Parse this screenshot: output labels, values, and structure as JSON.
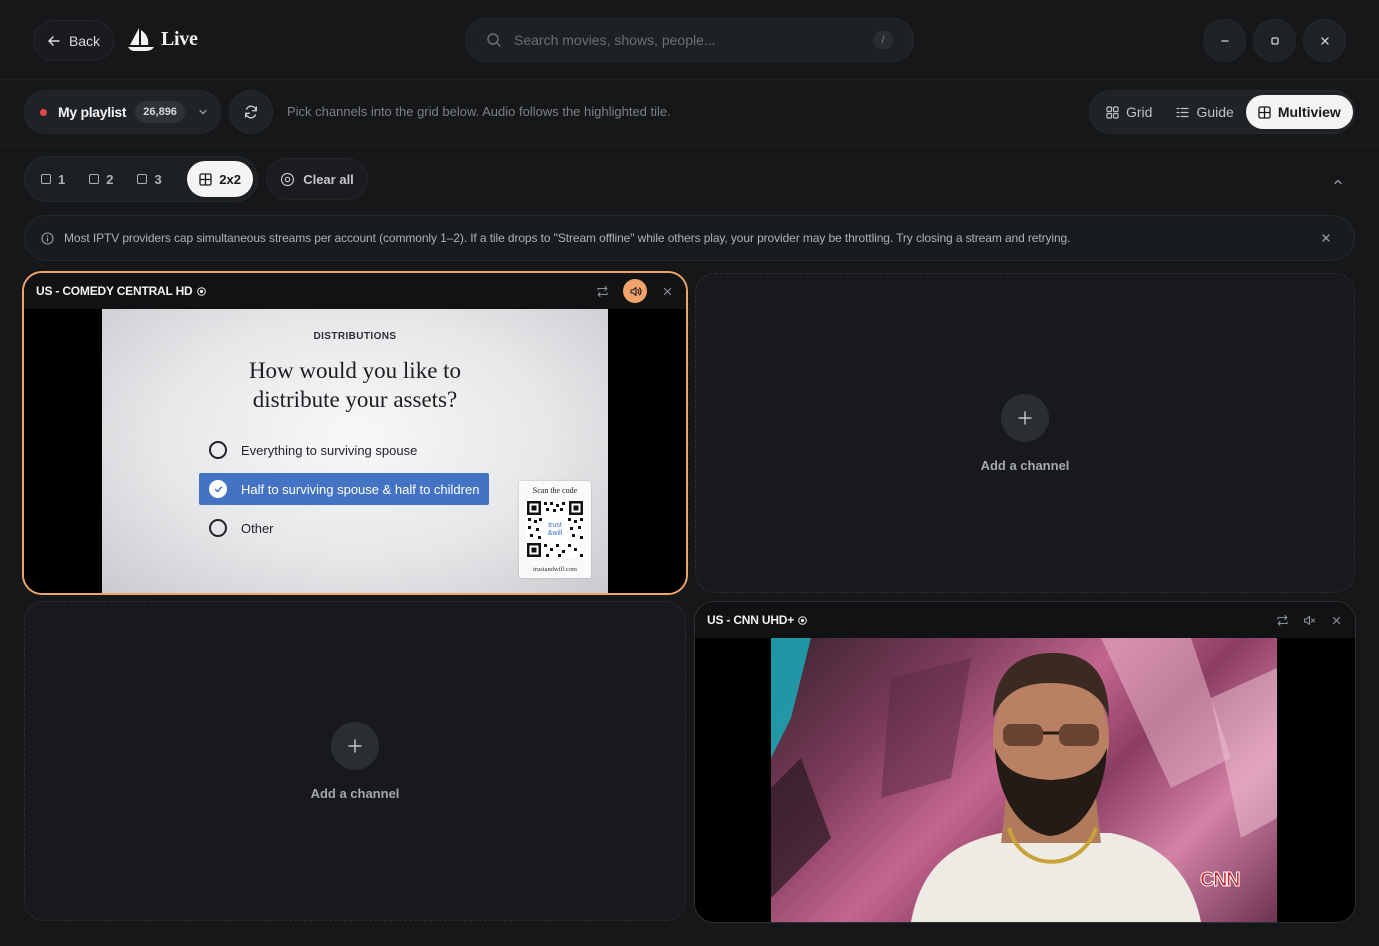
{
  "header": {
    "back_label": "Back",
    "logo_text": "Live",
    "search_placeholder": "Search movies, shows, people...",
    "search_shortcut": "/"
  },
  "toolbar": {
    "playlist_name": "My playlist",
    "playlist_count": "26,896",
    "hint": "Pick channels into the grid below. Audio follows the highlighted tile.",
    "views": [
      {
        "label": "Grid",
        "icon": "grid-icon",
        "active": false
      },
      {
        "label": "Guide",
        "icon": "guide-list-icon",
        "active": false
      },
      {
        "label": "Multiview",
        "icon": "multiview-icon",
        "active": true
      }
    ]
  },
  "layout": {
    "options": [
      {
        "label": "1",
        "active": false
      },
      {
        "label": "2",
        "active": false
      },
      {
        "label": "3",
        "active": false
      },
      {
        "label": "2x2",
        "active": true
      }
    ],
    "clear_label": "Clear all"
  },
  "notice": {
    "text": "Most IPTV providers cap simultaneous streams per account (commonly 1–2). If a tile drops to \"Stream offline\" while others play, your provider may be throttling. Try closing a stream and retrying."
  },
  "tiles": [
    {
      "title": "US - COMEDY CENTRAL HD",
      "focused": true,
      "audio": "on",
      "frame": {
        "kicker": "DISTRIBUTIONS",
        "question_line1": "How would you like to",
        "question_line2": "distribute your assets?",
        "options": [
          "Everything to surviving spouse",
          "Half to surviving spouse & half to children",
          "Other"
        ],
        "selected_index": 1,
        "qr_title": "Scan the code",
        "qr_url": "trustandwill.com"
      }
    },
    {
      "title": "",
      "empty": true,
      "add_label": "Add a channel"
    },
    {
      "title": "",
      "empty": true,
      "add_label": "Add a channel"
    },
    {
      "title": "US - CNN UHD+",
      "focused": false,
      "audio": "muted",
      "frame": {
        "bug": "CNN"
      }
    }
  ],
  "colors": {
    "accent": "#f0a36a",
    "live_dot": "#e5484d",
    "selected_option": "#4573c4"
  }
}
